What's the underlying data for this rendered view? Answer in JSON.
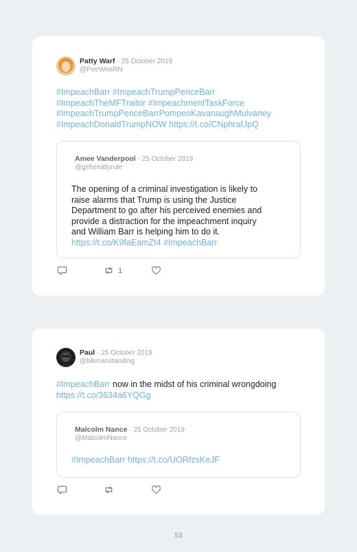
{
  "tweets": [
    {
      "author": "Patty Warf",
      "date": "· 25 October 2019",
      "handle": "@PeeWeeRN",
      "text_lines": [
        "#ImpeachBarr #ImpeachTrumpPenceBarr",
        "#ImpeachTheMFTraitor #ImpeachmentTaskForce",
        "#ImpeachTrumpPenceBarrPompeoKavanaughMulvaney",
        "#ImpeachDonaldTrumpNOW https://t.co/CNphrafJpQ"
      ],
      "quote": {
        "author": "Amee Vanderpool",
        "date": "· 25 October 2019",
        "handle": "@girlsreallyrule",
        "text_lines": [
          "The opening of a criminal investigation is likely to",
          "raise alarms that Trump is using the Justice",
          "Department to go after his perceived enemies and",
          "provide a distraction for the impeachment inquiry",
          "and William Barr is helping him to do it."
        ],
        "link_line": "https://t.co/K9faEamZt4 #ImpeachBarr"
      },
      "retweet_count": "1"
    },
    {
      "author": "Paul",
      "date": "· 25 October 2019",
      "handle": "@blkmanstanding",
      "text_hashtag": "#ImpeachBarr",
      "text_rest": " now in the midst of his criminal wrongdoing",
      "text_link": "https://t.co/3634a6YQGg",
      "quote": {
        "author": "Malcolm Nance",
        "date": "· 25 October 2019",
        "handle": "@MalcolmNance",
        "link_line": "#ImpeachBarr https://t.co/UORfzsKeJF"
      },
      "retweet_count": ""
    }
  ],
  "page_number": "53",
  "icons": {
    "reply": "speech-bubble-icon",
    "retweet": "retweet-icon",
    "like": "heart-icon"
  },
  "colors": {
    "background": "#edf0f2",
    "card": "#ffffff",
    "link": "#6fb3d8",
    "muted": "#9aa3a9"
  }
}
